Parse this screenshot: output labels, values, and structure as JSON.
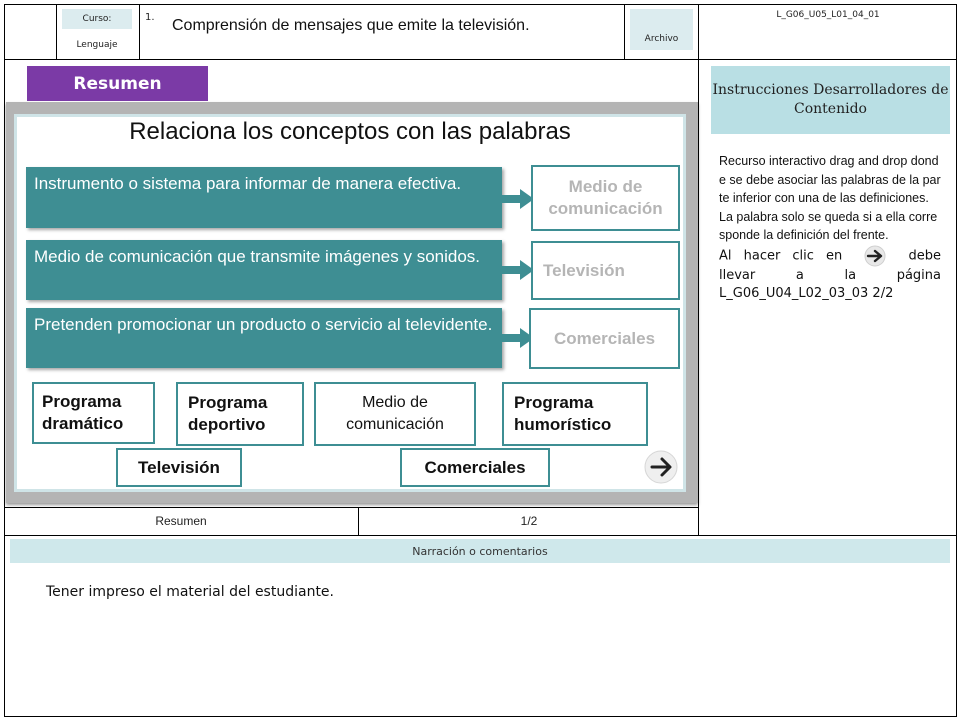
{
  "header": {
    "curso_label": "Curso:",
    "curso_value": "Lenguaje",
    "number": "1.",
    "title": "Comprensión de mensajes que emite la televisión.",
    "archivo_label": "Archivo",
    "code": "L_G06_U05_L01_04_01"
  },
  "section_button": "Resumen",
  "activity": {
    "title": "Relaciona los conceptos con las palabras",
    "rows": [
      {
        "definition": "Instrumento o sistema para informar de manera efectiva.",
        "answer": "Medio de comunicación"
      },
      {
        "definition": "Medio de comunicación que transmite imágenes y sonidos.",
        "answer": "Televisión"
      },
      {
        "definition": "Pretenden promocionar un producto o servicio al televidente.",
        "answer": "Comerciales"
      }
    ],
    "words": [
      "Programa dramático",
      "Programa deportivo",
      "Medio de comunicación",
      "Programa humorístico",
      "Televisión",
      "Comerciales"
    ]
  },
  "instructions": {
    "heading": "Instrucciones Desarrolladores de Contenido",
    "paragraph1": "Recurso interactivo drag and drop donde se debe asociar las palabras de la parte inferior con una de las definiciones.",
    "paragraph2": "La palabra solo se queda si a ella corresponde la definición del frente.",
    "paragraph3_before": "Al hacer clic en",
    "paragraph3_after": "debe llevar a la página L_G06_U04_L02_03_03 2/2"
  },
  "footer": {
    "section": "Resumen",
    "page": "1/2"
  },
  "narration": {
    "heading": "Narración o comentarios",
    "text": "Tener impreso el material del estudiante."
  },
  "colors": {
    "accent_purple": "#7b3aa6",
    "teal": "#3e8e93",
    "light_teal": "#b9dfe4"
  }
}
